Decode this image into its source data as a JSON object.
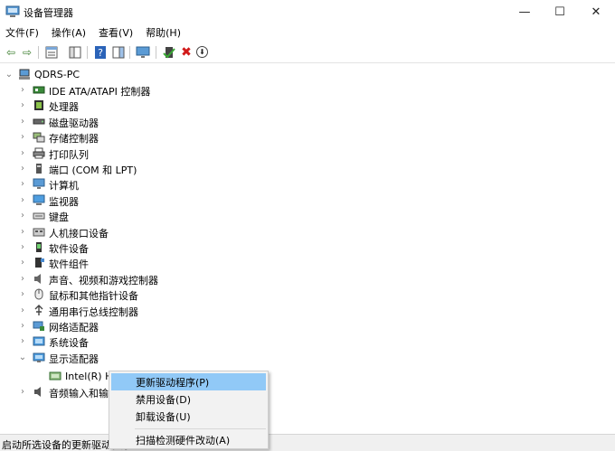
{
  "window": {
    "title": "设备管理器",
    "minimize_glyph": "—",
    "maximize_glyph": "☐",
    "close_glyph": "✕"
  },
  "menu": [
    "文件(F)",
    "操作(A)",
    "查看(V)",
    "帮助(H)"
  ],
  "toolbar": {
    "back_glyph": "⇦",
    "forward_glyph": "⇨",
    "remove_glyph": "✖",
    "down_glyph": "⬇"
  },
  "tree": {
    "root": "QDRS-PC",
    "categories": [
      "IDE ATA/ATAPI 控制器",
      "处理器",
      "磁盘驱动器",
      "存储控制器",
      "打印队列",
      "端口 (COM 和 LPT)",
      "计算机",
      "监视器",
      "键盘",
      "人机接口设备",
      "软件设备",
      "软件组件",
      "声音、视频和游戏控制器",
      "鼠标和其他指针设备",
      "通用串行总线控制器",
      "网络适配器",
      "系统设备",
      "显示适配器"
    ],
    "child": "Intel(R) HD",
    "after": "音频输入和输出",
    "collapsed_glyph": "›",
    "expanded_glyph": "⌄"
  },
  "context_menu": {
    "items": [
      "更新驱动程序(P)",
      "禁用设备(D)",
      "卸载设备(U)",
      "扫描检测硬件改动(A)"
    ],
    "highlighted_index": 0
  },
  "status": "启动所选设备的更新驱动程序"
}
